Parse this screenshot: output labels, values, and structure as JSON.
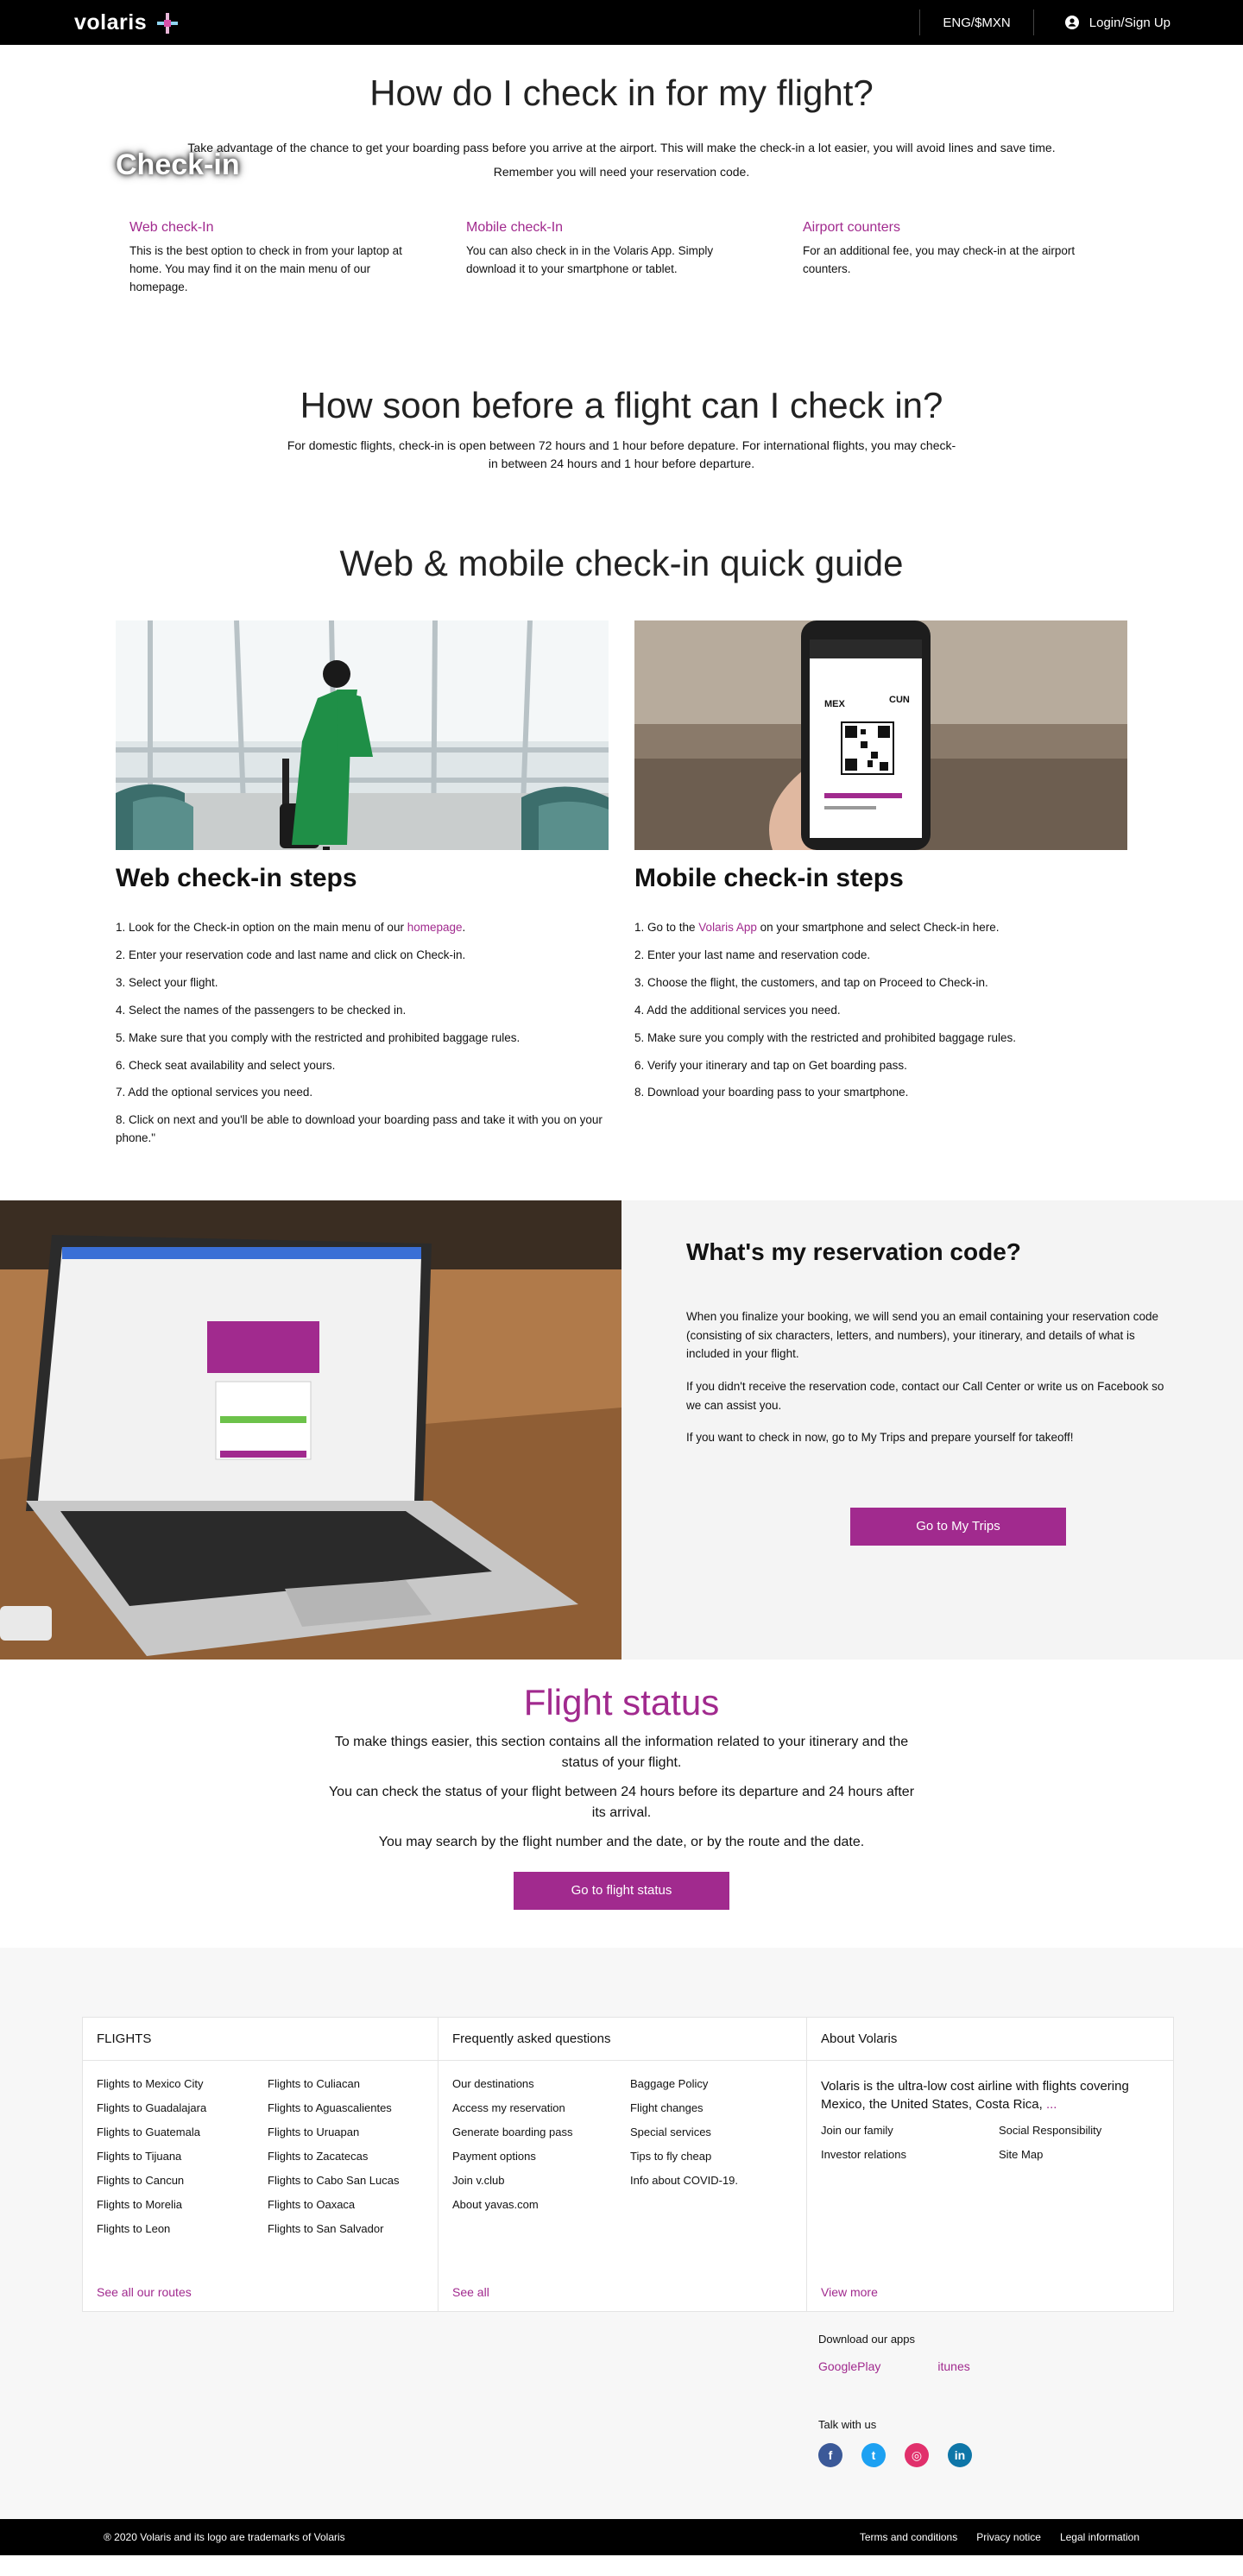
{
  "header": {
    "brand": "volaris",
    "language": "ENG/$MXN",
    "login": "Login/Sign Up"
  },
  "checkin": {
    "title": "How do I check in for my flight?",
    "tag": "Check-in",
    "intro1": "Take advantage of the chance to get your boarding pass before you arrive at the airport. This will make the check-in a lot easier, you will avoid lines and save time.",
    "intro2": "Remember you will need your reservation code.",
    "options": [
      {
        "title": "Web check-In",
        "text": "This is the best option to check in from your laptop at home. You may find it on the main menu of our homepage."
      },
      {
        "title": "Mobile check-In",
        "text": "You can also check in in the Volaris App. Simply download it to your smartphone or tablet."
      },
      {
        "title": "Airport counters",
        "text": "For an additional fee, you may check-in at the airport counters."
      }
    ]
  },
  "timing": {
    "title": "How soon before a flight can I check in?",
    "text": "For domestic flights, check-in is open between 72 hours and 1 hour before depature. For international flights, you may check-in between 24 hours and 1 hour before departure."
  },
  "guide": {
    "title": "Web & mobile check-in quick guide",
    "web_title": "Web check-in steps",
    "web_step1_pre": "1. Look for the Check-in option on the main menu of our ",
    "web_step1_link": "homepage",
    "web_step1_post": ".",
    "web_steps": [
      "2. Enter your reservation code and last name and click on Check-in.",
      "3. Select your flight.",
      "4. Select the names of the passengers to be checked in.",
      "5. Make sure that you comply with the restricted and prohibited baggage rules.",
      "6. Check seat availability and select yours.",
      "7. Add the optional services you need.",
      "8. Click on next and you'll be able to download your boarding pass and take it with you on your phone.\""
    ],
    "mobile_title": "Mobile check-in steps",
    "mobile_step1_pre": "1. Go to the ",
    "mobile_step1_link": "Volaris App",
    "mobile_step1_post": " on your smartphone and select Check-in here.",
    "mobile_steps": [
      "2. Enter your last name and reservation code.",
      "3. Choose the flight, the customers, and tap on Proceed to Check-in.",
      "4. Add the additional services you need.",
      "5. Make sure you comply with the restricted and prohibited baggage rules.",
      "6. Verify your itinerary and tap on Get boarding pass.",
      "8. Download your boarding pass to your smartphone."
    ],
    "phone_from": "MEX",
    "phone_to": "CUN"
  },
  "reservation": {
    "title": "What's my reservation code?",
    "p1": "When you finalize your booking, we will send you an email containing your reservation code (consisting of six characters, letters, and numbers), your itinerary, and details of what is included in your flight.",
    "p2": "If you didn't receive the reservation code, contact our Call Center or write us on Facebook so we can assist you.",
    "p3": "If you want to check in now, go to My Trips and prepare yourself for takeoff!",
    "button": "Go to My Trips"
  },
  "status": {
    "title": "Flight status",
    "p1": "To make things easier, this section contains all the information related to your itinerary and the status of your flight.",
    "p2": "You can check the status of your flight between 24 hours before its departure and 24 hours after its arrival.",
    "p3": "You may search by the flight number and the date, or by the route and the date.",
    "button": "Go to flight status"
  },
  "footer": {
    "flights_title": "FLIGHTS",
    "flights": [
      "Flights to Mexico City",
      "Flights to Culiacan",
      "Flights to Guadalajara",
      "Flights to Aguascalientes",
      "Flights to Guatemala",
      "Flights to Uruapan",
      "Flights to Tijuana",
      "Flights to Zacatecas",
      "Flights to Cancun",
      "Flights to Cabo San Lucas",
      "Flights to Morelia",
      "Flights to Oaxaca",
      "Flights to Leon",
      "Flights to San Salvador"
    ],
    "flights_more": "See all our routes",
    "faq_title": "Frequently asked questions",
    "faq": [
      "Our destinations",
      "Baggage Policy",
      "Access my reservation",
      "Flight changes",
      "Generate boarding pass",
      "Special services",
      "Payment options",
      "Tips to fly cheap",
      "Join v.club",
      "Info about COVID-19.",
      "About yavas.com"
    ],
    "faq_more": "See all",
    "about_title": "About Volaris",
    "about_text": "Volaris is the ultra-low cost airline with flights covering Mexico, the United States, Costa Rica, ",
    "about_ellipsis": "...",
    "about_links": [
      "Join our family",
      "Social Responsibility",
      "Investor relations",
      "Site Map"
    ],
    "about_more": "View more",
    "apps_title": "Download our apps",
    "google_play": "GooglePlay",
    "itunes": "itunes",
    "talk": "Talk with us",
    "copyright": "® 2020 Volaris and its logo are trademarks of Volaris",
    "legal": [
      "Terms and conditions",
      "Privacy notice",
      "Legal information"
    ]
  },
  "colors": {
    "accent": "#a12a8e",
    "topbar": "#000000"
  },
  "icons": {
    "user": "user-icon",
    "facebook": "facebook-icon",
    "twitter": "twitter-icon",
    "instagram": "instagram-icon",
    "linkedin": "linkedin-icon"
  }
}
